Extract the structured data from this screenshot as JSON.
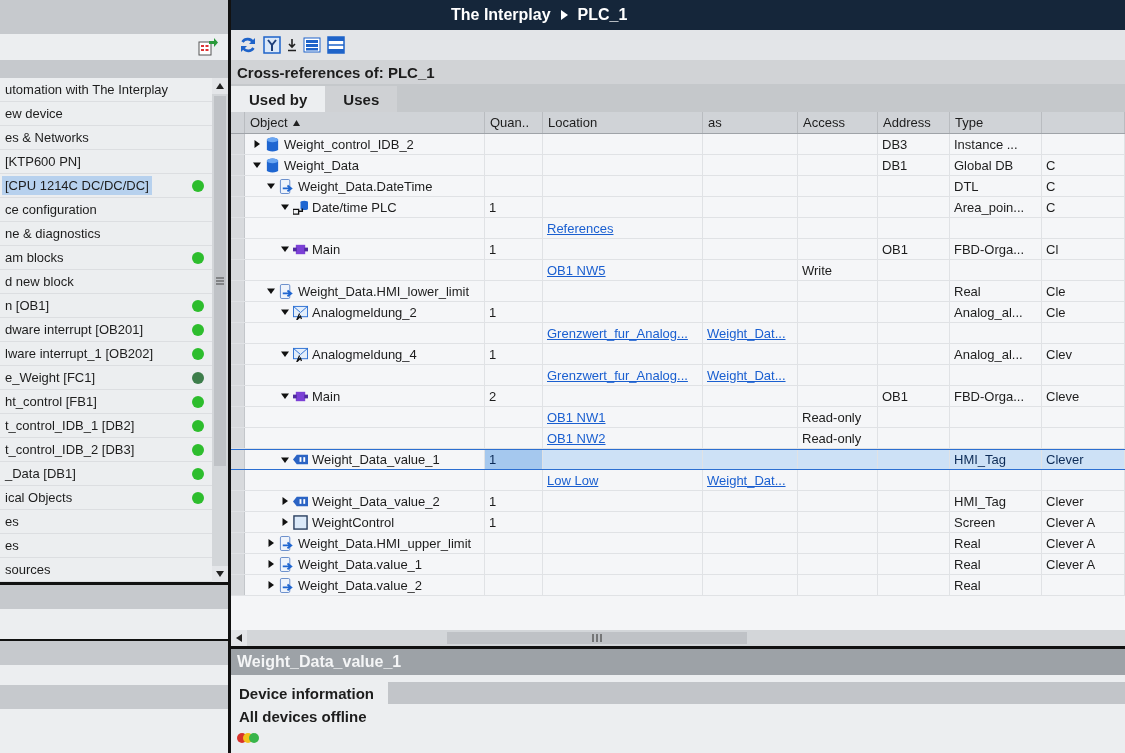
{
  "project_tree": {
    "items": [
      {
        "label": "utomation with The Interplay",
        "selected": false
      },
      {
        "label": "ew device",
        "selected": false
      },
      {
        "label": "es & Networks",
        "selected": false
      },
      {
        "label": "[KTP600 PN]",
        "selected": false
      },
      {
        "label": "[CPU 1214C DC/DC/DC]",
        "selected": true,
        "color": "#2dbd2d"
      },
      {
        "label": "ce configuration",
        "selected": false
      },
      {
        "label": "ne & diagnostics",
        "selected": false
      },
      {
        "label": "am blocks",
        "selected": false,
        "color": "#2dbd2d"
      },
      {
        "label": "d new block",
        "selected": false
      },
      {
        "label": "n [OB1]",
        "selected": false,
        "color": "#2dbd2d"
      },
      {
        "label": "dware interrupt [OB201]",
        "selected": false,
        "color": "#2dbd2d"
      },
      {
        "label": "lware interrupt_1 [OB202]",
        "selected": false,
        "color": "#2dbd2d"
      },
      {
        "label": "e_Weight [FC1]",
        "selected": false,
        "color": "#3d7d4b"
      },
      {
        "label": "ht_control [FB1]",
        "selected": false,
        "color": "#2dbd2d"
      },
      {
        "label": "t_control_IDB_1 [DB2]",
        "selected": false,
        "color": "#2dbd2d"
      },
      {
        "label": "t_control_IDB_2 [DB3]",
        "selected": false,
        "color": "#2dbd2d"
      },
      {
        "label": "_Data [DB1]",
        "selected": false,
        "color": "#2dbd2d"
      },
      {
        "label": "ical Objects",
        "selected": false,
        "color": "#2dbd2d"
      },
      {
        "label": "es",
        "selected": false
      },
      {
        "label": "es",
        "selected": false
      },
      {
        "label": "sources",
        "selected": false
      }
    ]
  },
  "editor": {
    "breadcrumb": [
      "The Interplay",
      "PLC_1"
    ],
    "title": "Cross-references of: PLC_1",
    "tabs": [
      {
        "label": "Used by",
        "selected": true
      },
      {
        "label": "Uses",
        "selected": false
      }
    ],
    "table": {
      "columns": [
        {
          "label": "Object",
          "sorted": true
        },
        {
          "label": "Quan..",
          "sorted": false
        },
        {
          "label": "Location",
          "sorted": false
        },
        {
          "label": "as",
          "sorted": false
        },
        {
          "label": "Access",
          "sorted": false
        },
        {
          "label": "Address",
          "sorted": false
        },
        {
          "label": "Type",
          "sorted": false
        }
      ],
      "rows": [
        {
          "kind": "data-block",
          "name": "Weight_control_IDB_2",
          "expanded": false,
          "selected": false,
          "address": "DB3",
          "type": "Instance ..."
        },
        {
          "kind": "data-block",
          "name": "Weight_Data",
          "expanded": true,
          "selected": false,
          "address": "DB1",
          "type": "Global DB",
          "column_8": "C",
          "children": [
            {
              "kind": "tag",
              "name": "Weight_Data.DateTime",
              "expanded": true,
              "selected": false,
              "type": "DTL",
              "column_8": "C",
              "children": [
                {
                  "kind": "connection",
                  "name": "Date/time PLC",
                  "expanded": true,
                  "selected": false,
                  "quantity": "1",
                  "type": "Area_poin...",
                  "column_8": "C",
                  "references": [
                    {
                      "location": "References",
                      "selected": false
                    }
                  ]
                },
                {
                  "kind": "program-block",
                  "name": "Main",
                  "expanded": true,
                  "selected": false,
                  "quantity": "1",
                  "address": "OB1",
                  "type": "FBD-Orga...",
                  "column_8": "Cl",
                  "references": [
                    {
                      "location": "OB1 NW5",
                      "access": "Write",
                      "selected": false
                    }
                  ]
                }
              ]
            },
            {
              "kind": "tag",
              "name": "Weight_Data.HMI_lower_limit",
              "expanded": true,
              "selected": false,
              "type": "Real",
              "column_8": "Cle",
              "children": [
                {
                  "kind": "alarm",
                  "name": "Analogmeldung_2",
                  "expanded": true,
                  "selected": false,
                  "quantity": "1",
                  "type": "Analog_al...",
                  "column_8": "Cle",
                  "references": [
                    {
                      "location": "Grenzwert_fur_Analog...",
                      "as": "Weight_Dat...",
                      "selected": false
                    }
                  ]
                },
                {
                  "kind": "alarm",
                  "name": "Analogmeldung_4",
                  "expanded": true,
                  "selected": false,
                  "quantity": "1",
                  "type": "Analog_al...",
                  "column_8": "Clev",
                  "references": [
                    {
                      "location": "Grenzwert_fur_Analog...",
                      "as": "Weight_Dat...",
                      "selected": false
                    }
                  ]
                },
                {
                  "kind": "program-block",
                  "name": "Main",
                  "expanded": true,
                  "selected": false,
                  "quantity": "2",
                  "address": "OB1",
                  "type": "FBD-Orga...",
                  "column_8": "Cleve",
                  "references": [
                    {
                      "location": "OB1 NW1",
                      "access": "Read-only",
                      "selected": false
                    },
                    {
                      "location": "OB1 NW2",
                      "access": "Read-only",
                      "selected": false
                    }
                  ]
                },
                {
                  "kind": "hmi-tag",
                  "name": "Weight_Data_value_1",
                  "expanded": true,
                  "selected": true,
                  "quantity": "1",
                  "type": "HMI_Tag",
                  "column_8": "Clever",
                  "references": [
                    {
                      "location": "Low Low",
                      "as": "Weight_Dat...",
                      "selected": false
                    }
                  ]
                },
                {
                  "kind": "hmi-tag",
                  "name": "Weight_Data_value_2",
                  "expanded": false,
                  "selected": false,
                  "quantity": "1",
                  "type": "HMI_Tag",
                  "column_8": "Clever"
                },
                {
                  "kind": "screen",
                  "name": "WeightControl",
                  "expanded": false,
                  "selected": false,
                  "quantity": "1",
                  "type": "Screen",
                  "column_8": "Clever A"
                }
              ]
            },
            {
              "kind": "tag",
              "name": "Weight_Data.HMI_upper_limit",
              "expanded": false,
              "selected": false,
              "type": "Real",
              "column_8": "Clever A"
            },
            {
              "kind": "tag",
              "name": "Weight_Data.value_1",
              "expanded": false,
              "selected": false,
              "type": "Real",
              "column_8": "Clever A"
            },
            {
              "kind": "tag",
              "name": "Weight_Data.value_2",
              "expanded": false,
              "selected": false,
              "type": "Real"
            }
          ]
        }
      ]
    }
  },
  "inspector": {
    "title": "Weight_Data_value_1",
    "heading": "Device information",
    "status": "All devices offline"
  }
}
